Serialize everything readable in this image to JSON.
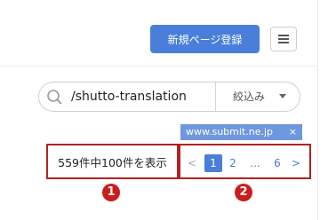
{
  "header": {
    "new_page_button": "新規ページ登録"
  },
  "search": {
    "value": "/shutto-translation",
    "filter_label": "絞込み"
  },
  "tag": {
    "label": "www.submit.ne.jp",
    "close": "×"
  },
  "results": {
    "count_text": "559件中100件を表示"
  },
  "pagination": {
    "prev": "<",
    "pages": [
      "1",
      "2"
    ],
    "ellipsis": "...",
    "last": "6",
    "next": ">",
    "current": "1"
  },
  "annotations": {
    "marker_1": "1",
    "marker_2": "2"
  },
  "colors": {
    "primary": "#4a7fd9",
    "tag": "#6f97df",
    "annotation": "#b22222"
  },
  "icons": {
    "menu": "hamburger-icon",
    "search": "search-icon",
    "filter_caret": "caret-down-icon"
  }
}
